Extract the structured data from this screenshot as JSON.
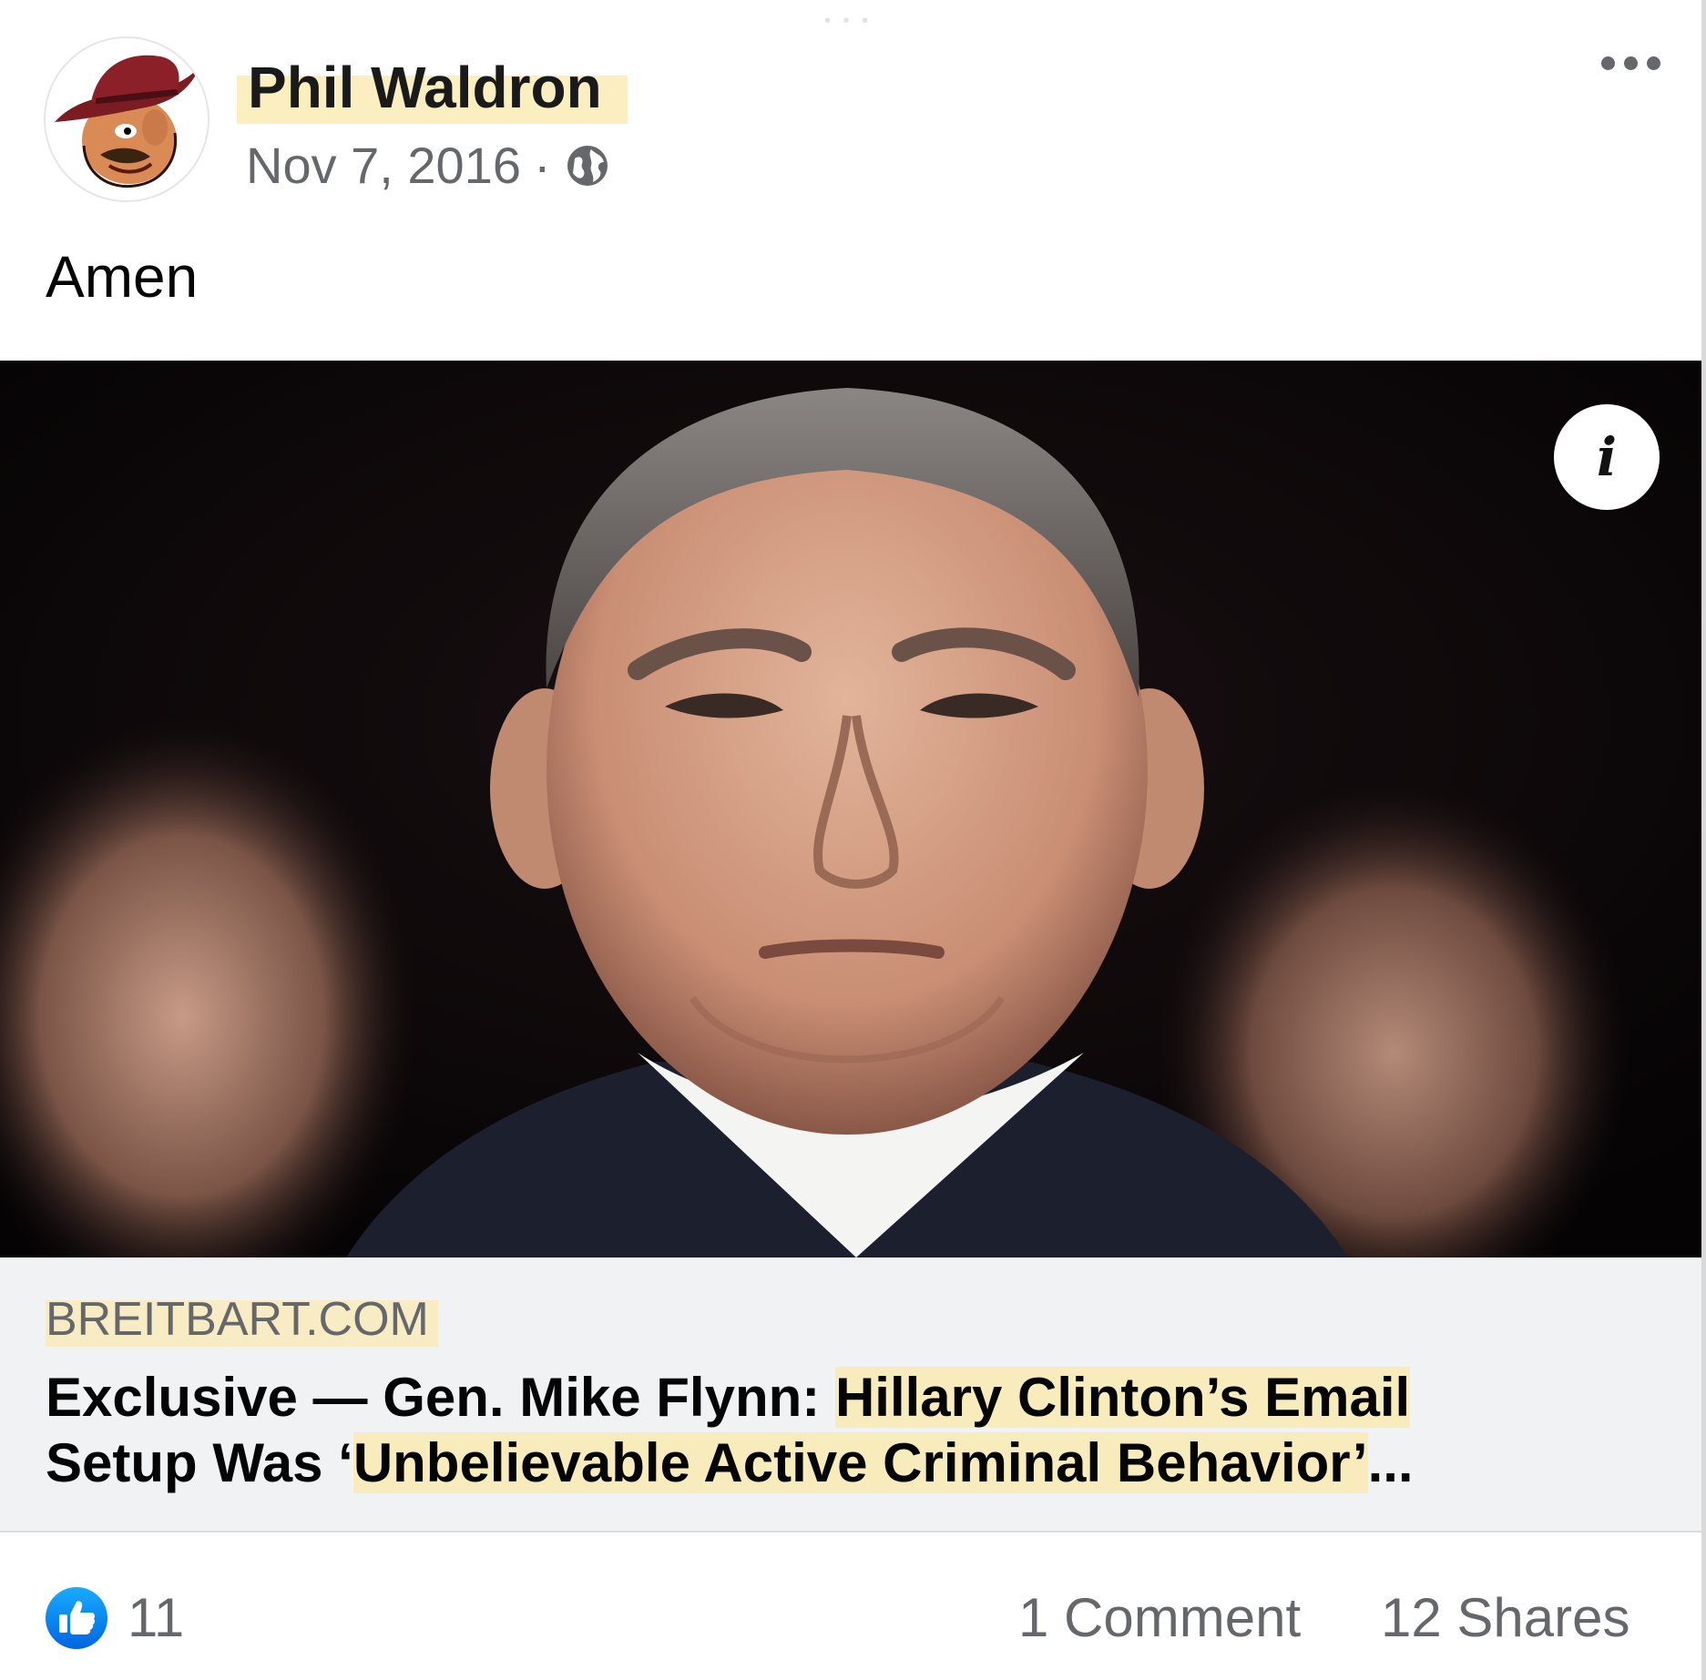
{
  "post": {
    "author": "Phil Waldron",
    "date": "Nov 7, 2016",
    "separator": "·",
    "privacy_icon": "globe-icon",
    "more_icon": "more-options-icon",
    "text": "Amen"
  },
  "link": {
    "image_info_icon": "info-icon",
    "image_info_glyph": "i",
    "domain": "BREITBART.COM",
    "headline_part1": "Exclusive — Gen. Mike Flynn: ",
    "headline_part2": "Hillary Clinton’s Email",
    "headline_part3": "Setup Was ‘",
    "headline_part4": "Unbelievable Active Criminal Behavior’",
    "headline_part5": "..."
  },
  "footer": {
    "reaction_icon": "like-icon",
    "reaction_count": "11",
    "comments": "1 Comment",
    "shares": "12 Shares"
  },
  "colors": {
    "highlight": "#fae8aa",
    "like_blue": "#1877f2",
    "secondary_text": "#65676b",
    "caption_bg": "#f1f2f4"
  }
}
